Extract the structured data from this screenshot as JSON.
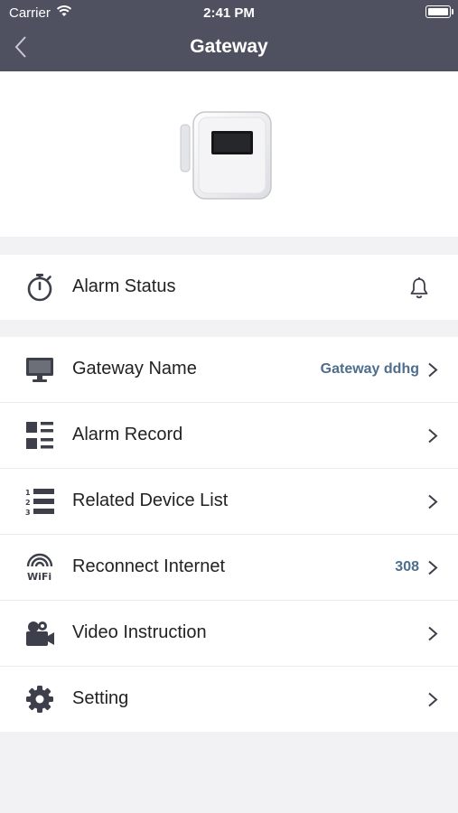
{
  "status_bar": {
    "carrier": "Carrier",
    "time": "2:41 PM"
  },
  "nav": {
    "title": "Gateway"
  },
  "alarm_status": {
    "label": "Alarm Status"
  },
  "menu": {
    "gateway_name": {
      "label": "Gateway Name",
      "value": "Gateway ddhg"
    },
    "alarm_record": {
      "label": "Alarm Record"
    },
    "related_device_list": {
      "label": "Related Device List"
    },
    "reconnect_internet": {
      "label": "Reconnect Internet",
      "value": "308"
    },
    "video_instruction": {
      "label": "Video Instruction"
    },
    "setting": {
      "label": "Setting"
    }
  },
  "colors": {
    "header_bg": "#4f5160",
    "page_bg": "#f2f2f4",
    "value_text": "#4d6e8c",
    "icon": "#3d3f4a"
  }
}
